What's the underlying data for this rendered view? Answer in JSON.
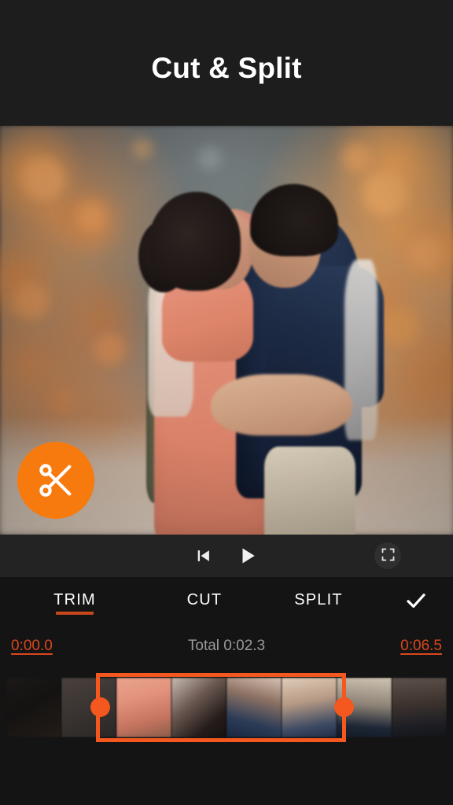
{
  "header": {
    "title": "Cut & Split"
  },
  "preview": {
    "fab": {
      "icon": "scissors-icon",
      "color": "#f77a0f"
    }
  },
  "playback": {
    "skip_to_start_icon": "skip-previous-icon",
    "play_icon": "play-icon",
    "fullscreen_icon": "fullscreen-crop-icon"
  },
  "tabs": {
    "items": [
      {
        "label": "TRIM",
        "active": true
      },
      {
        "label": "CUT",
        "active": false
      },
      {
        "label": "SPLIT",
        "active": false
      }
    ],
    "confirm_icon": "checkmark-icon",
    "active_underline_color": "#c8471d"
  },
  "time": {
    "start": "0:00.0",
    "total": "Total 0:02.3",
    "end": "0:06.5",
    "accent_color": "#d9471c"
  },
  "timeline": {
    "selection_color": "#f4581f",
    "thumbnails": [
      {
        "selected": false
      },
      {
        "selected": false
      },
      {
        "selected": true
      },
      {
        "selected": true
      },
      {
        "selected": true
      },
      {
        "selected": true
      },
      {
        "selected": true
      },
      {
        "selected": false
      }
    ],
    "left_handle": "trim-handle-left",
    "right_handle": "trim-handle-right"
  }
}
